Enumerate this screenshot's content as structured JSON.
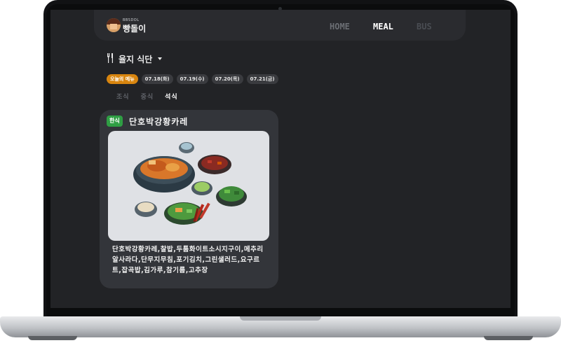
{
  "nav": {
    "logo_small": "BBSDOL",
    "logo_title": "빵돌이",
    "links": {
      "home": "HOME",
      "meal": "MEAL",
      "bus": "BUS"
    }
  },
  "dining": {
    "title": "율지 식단",
    "chips": [
      "오늘의 메뉴",
      "07.18(화)",
      "07.19(수)",
      "07.20(목)",
      "07.21(금)"
    ],
    "tabs": [
      "조식",
      "중식",
      "석식"
    ]
  },
  "card": {
    "badge": "한식",
    "title": "단호박강황카레",
    "menu": "단호박강황카레,찰밥,두툼화이트소시지구이,메추리알사라다,단무지무침,포기김치,그린샐러드,요구르트,잡곡밥,김가루,참기름,고추장"
  },
  "colors": {
    "screen_bg": "#222326",
    "accent_orange": "#d8850f",
    "badge_green": "#2f9e44",
    "card_bg": "#33353a"
  }
}
